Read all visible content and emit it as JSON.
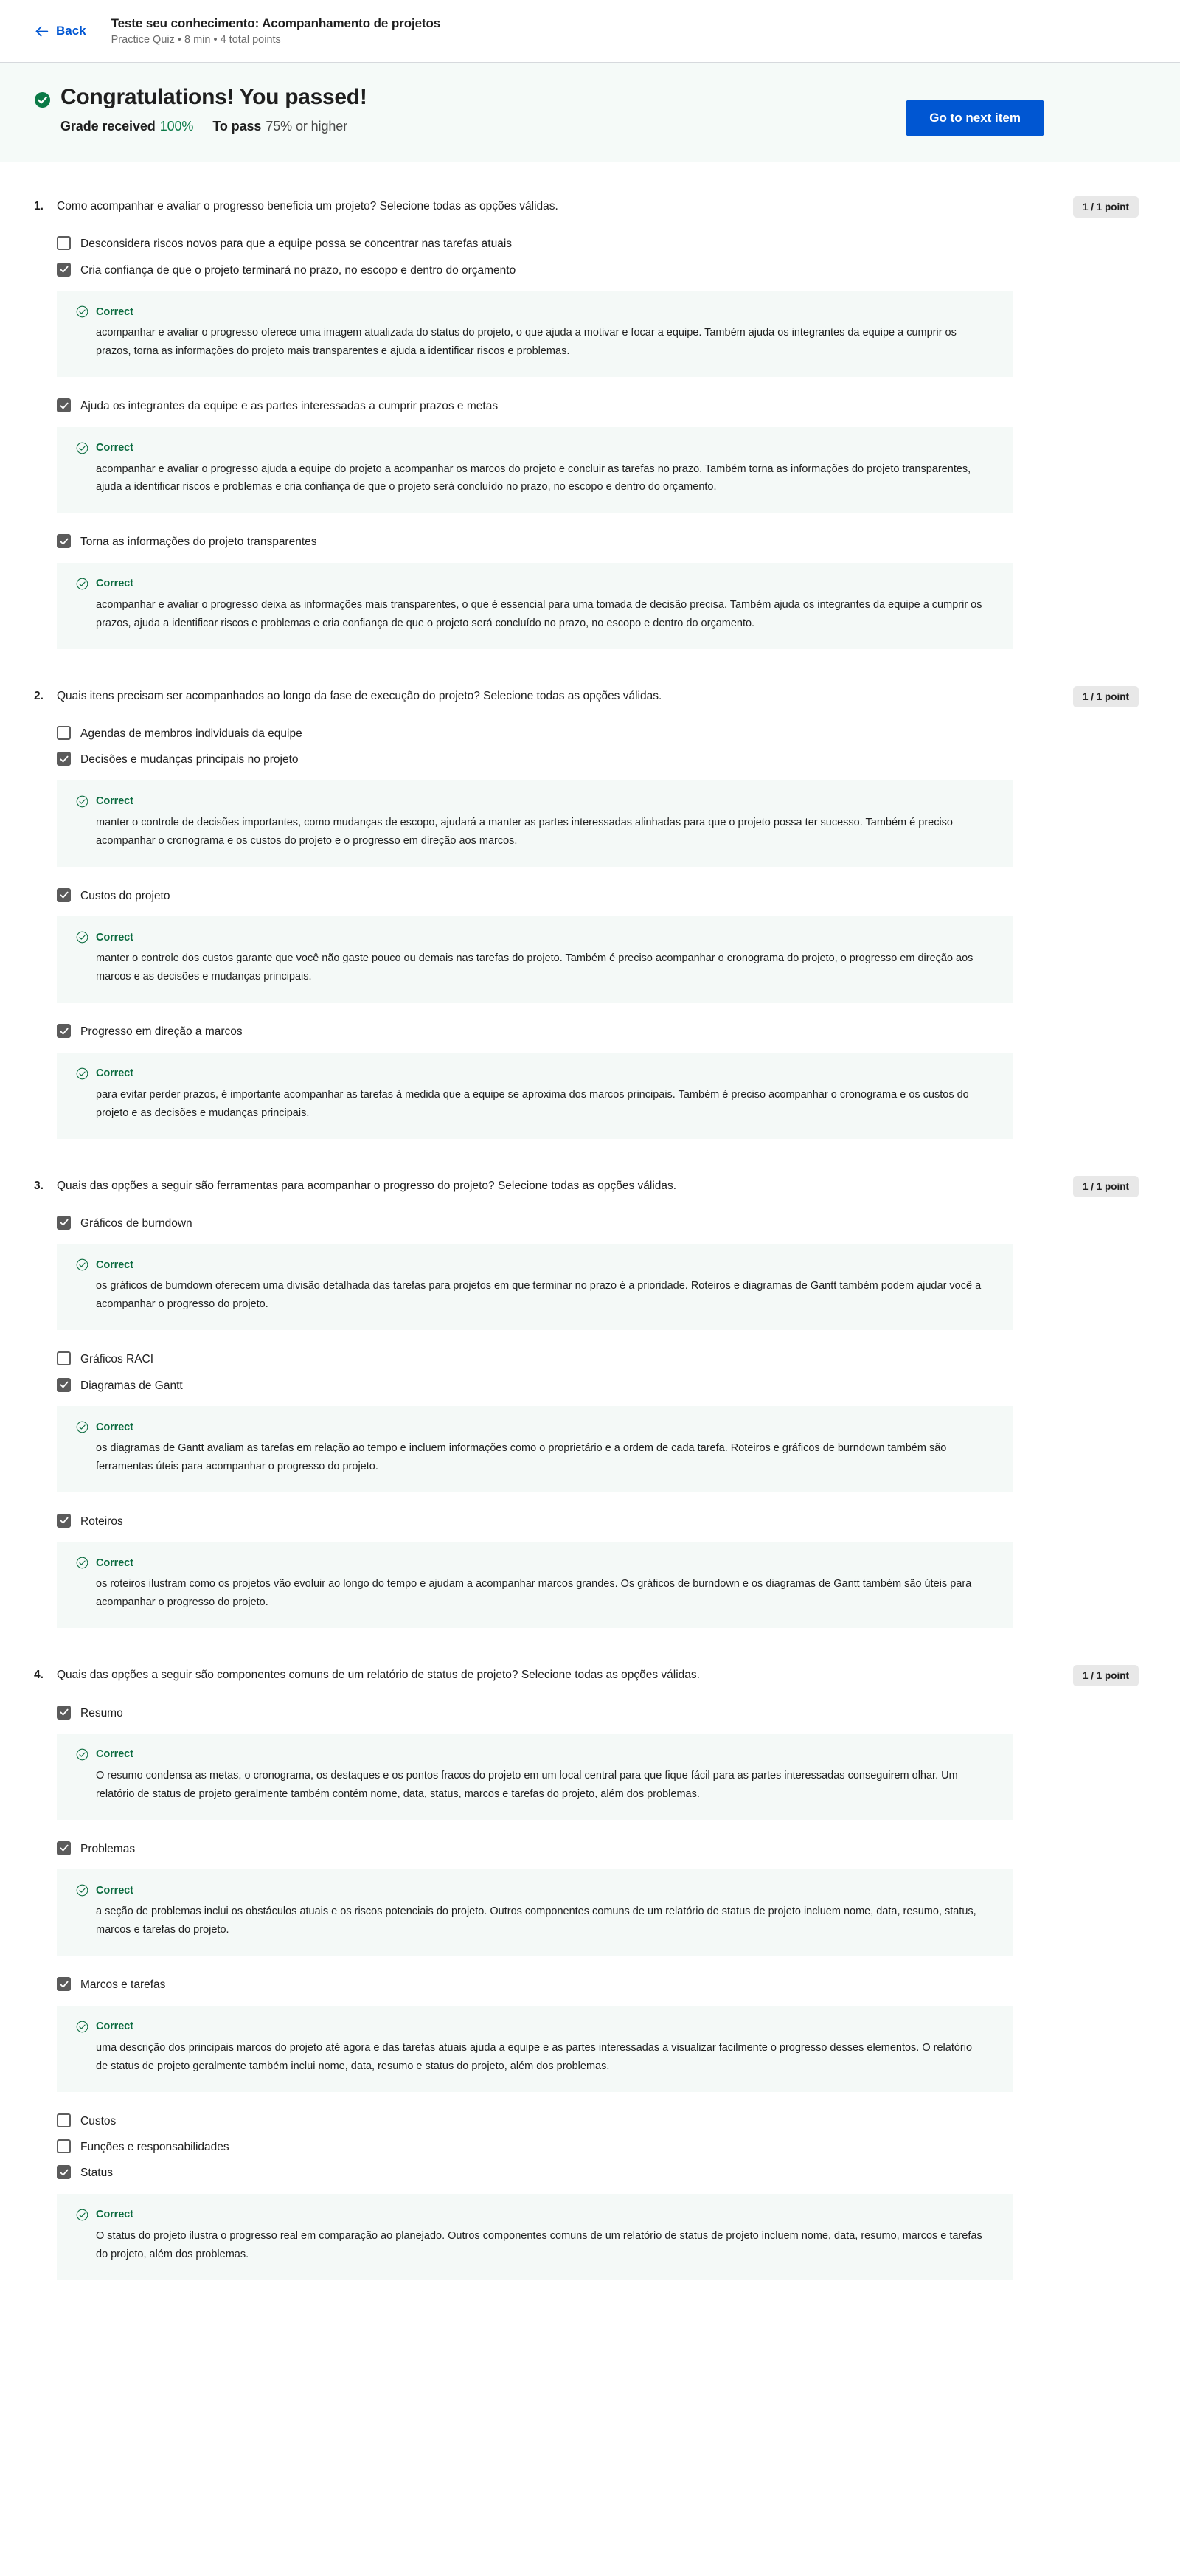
{
  "header": {
    "back_label": "Back",
    "back_icon": "arrow-left-icon",
    "quiz_title": "Teste seu conhecimento: Acompanhamento de projetos",
    "quiz_meta": "Practice Quiz • 8 min • 4 total points"
  },
  "banner": {
    "status_icon": "check-circle-filled-icon",
    "heading": "Congratulations! You passed!",
    "grade_label": "Grade received",
    "grade_value": "100%",
    "topass_label": "To pass",
    "topass_value": "75% or higher",
    "next_button": "Go to next item",
    "accent_color": "#0056d2",
    "success_color": "#0b7a47",
    "banner_bg": "#f5faf8"
  },
  "feedback_common": {
    "icon": "check-circle-outline-icon",
    "label": "Correct"
  },
  "questions": [
    {
      "number": "1.",
      "text": "Como acompanhar e avaliar o progresso beneficia um projeto? Selecione todas as opções válidas.",
      "points": "1 / 1 point",
      "options": [
        {
          "checked": false,
          "label": "Desconsidera riscos novos para que a equipe possa se concentrar nas tarefas atuais",
          "feedback": null
        },
        {
          "checked": true,
          "label": "Cria confiança de que o projeto terminará no prazo, no escopo e dentro do orçamento",
          "feedback": "acompanhar e avaliar o progresso oferece uma imagem atualizada do status do projeto, o que ajuda a motivar e focar a equipe. Também ajuda os integrantes da equipe a cumprir os prazos, torna as informações do projeto mais transparentes e ajuda a identificar riscos e problemas."
        },
        {
          "checked": true,
          "label": "Ajuda os integrantes da equipe e as partes interessadas a cumprir prazos e metas",
          "feedback": "acompanhar e avaliar o progresso ajuda a equipe do projeto a acompanhar os marcos do projeto e concluir as tarefas no prazo. Também torna as informações do projeto transparentes, ajuda a identificar riscos e problemas e cria confiança de que o projeto será concluído no prazo, no escopo e dentro do orçamento."
        },
        {
          "checked": true,
          "label": "Torna as informações do projeto transparentes",
          "feedback": "acompanhar e avaliar o progresso deixa as informações mais transparentes, o que é essencial para uma tomada de decisão precisa. Também ajuda os integrantes da equipe a cumprir os prazos, ajuda a identificar riscos e problemas e cria confiança de que o projeto será concluído no prazo, no escopo e dentro do orçamento."
        }
      ]
    },
    {
      "number": "2.",
      "text": "Quais itens precisam ser acompanhados ao longo da fase de execução do projeto? Selecione todas as opções válidas.",
      "points": "1 / 1 point",
      "options": [
        {
          "checked": false,
          "label": "Agendas de membros individuais da equipe",
          "feedback": null
        },
        {
          "checked": true,
          "label": "Decisões e mudanças principais no projeto",
          "feedback": "manter o controle de decisões importantes, como mudanças de escopo, ajudará a manter as partes interessadas alinhadas para que o projeto possa ter sucesso. Também é preciso acompanhar o cronograma e os custos do projeto e o progresso em direção aos marcos."
        },
        {
          "checked": true,
          "label": "Custos do projeto",
          "feedback": "manter o controle dos custos garante que você não gaste pouco ou demais nas tarefas do projeto. Também é preciso acompanhar o cronograma do projeto, o progresso em direção aos marcos e as decisões e mudanças principais."
        },
        {
          "checked": true,
          "label": "Progresso em direção a marcos",
          "feedback": "para evitar perder prazos, é importante acompanhar as tarefas à medida que a equipe se aproxima dos marcos principais. Também é preciso acompanhar o cronograma e os custos do projeto e as decisões e mudanças principais."
        }
      ]
    },
    {
      "number": "3.",
      "text": "Quais das opções a seguir são ferramentas para acompanhar o progresso do projeto? Selecione todas as opções válidas.",
      "points": "1 / 1 point",
      "options": [
        {
          "checked": true,
          "label": "Gráficos de burndown",
          "feedback": "os gráficos de burndown oferecem uma divisão detalhada das tarefas para projetos em que terminar no prazo é a prioridade. Roteiros e diagramas de Gantt também podem ajudar você a acompanhar o progresso do projeto."
        },
        {
          "checked": false,
          "label": "Gráficos RACI",
          "feedback": null
        },
        {
          "checked": true,
          "label": "Diagramas de Gantt",
          "feedback": "os diagramas de Gantt avaliam as tarefas em relação ao tempo e incluem informações como o proprietário e a ordem de cada tarefa. Roteiros e gráficos de burndown também são ferramentas úteis para acompanhar o progresso do projeto."
        },
        {
          "checked": true,
          "label": "Roteiros",
          "feedback": "os roteiros ilustram como os projetos vão evoluir ao longo do tempo e ajudam a acompanhar marcos grandes. Os gráficos de burndown e os diagramas de Gantt também são úteis para acompanhar o progresso do projeto."
        }
      ]
    },
    {
      "number": "4.",
      "text": "Quais das opções a seguir são componentes comuns de um relatório de status de projeto? Selecione todas as opções válidas.",
      "points": "1 / 1 point",
      "options": [
        {
          "checked": true,
          "label": "Resumo",
          "feedback": "O resumo condensa as metas, o cronograma, os destaques e os pontos fracos do projeto em um local central para que fique fácil para as partes interessadas conseguirem olhar. Um relatório de status de projeto geralmente também contém nome, data, status, marcos e tarefas do projeto, além dos problemas."
        },
        {
          "checked": true,
          "label": "Problemas",
          "feedback": "a seção de problemas inclui os obstáculos atuais e os riscos potenciais do projeto. Outros componentes comuns de um relatório de status de projeto incluem nome, data, resumo, status, marcos e tarefas do projeto."
        },
        {
          "checked": true,
          "label": "Marcos e tarefas",
          "feedback": "uma descrição dos principais marcos do projeto até agora e das tarefas atuais ajuda a equipe e as partes interessadas a visualizar facilmente o progresso desses elementos. O relatório de status de projeto geralmente também inclui nome, data, resumo e status do projeto, além dos problemas."
        },
        {
          "checked": false,
          "label": "Custos",
          "feedback": null
        },
        {
          "checked": false,
          "label": "Funções e responsabilidades",
          "feedback": null
        },
        {
          "checked": true,
          "label": "Status",
          "feedback": "O status do projeto ilustra o progresso real em comparação ao planejado. Outros componentes comuns de um relatório de status de projeto incluem nome, data, resumo, marcos e tarefas do projeto, além dos problemas."
        }
      ]
    }
  ]
}
